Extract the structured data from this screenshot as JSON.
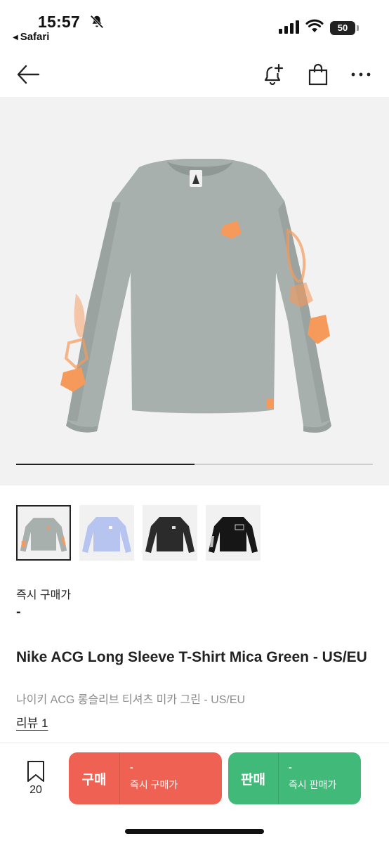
{
  "status_bar": {
    "time": "15:57",
    "back_app": "Safari",
    "battery": "50"
  },
  "header": {
    "back_icon": "arrow-left-icon",
    "alert_icon": "bell-plus-icon",
    "bag_icon": "shopping-bag-icon",
    "more_icon": "more-horizontal-icon"
  },
  "gallery": {
    "image_count": 2,
    "current_index": 1,
    "progress_fraction": 0.5,
    "thumbnails": [
      {
        "color": "#a7b0ac",
        "accent": "#f59a5b",
        "active": true
      },
      {
        "color": "#b7c4ef",
        "accent": "#ffffff",
        "active": false
      },
      {
        "color": "#2b2b2b",
        "accent": "#dddddd",
        "active": false
      },
      {
        "color": "#161616",
        "accent": "#cccccc",
        "active": false
      }
    ]
  },
  "product": {
    "price_label": "즉시 구매가",
    "price_value": "-",
    "title": "Nike ACG Long Sleeve T-Shirt Mica Green - US/EU",
    "subtitle": "나이키 ACG 롱슬리브 티셔츠 미카 그린 - US/EU",
    "review_link": "리뷰 1"
  },
  "bottom_bar": {
    "wish_count": "20",
    "buy": {
      "label": "구매",
      "value": "-",
      "sublabel": "즉시 구매가",
      "color": "#ef6253"
    },
    "sell": {
      "label": "판매",
      "value": "-",
      "sublabel": "즉시 판매가",
      "color": "#41b979"
    }
  }
}
